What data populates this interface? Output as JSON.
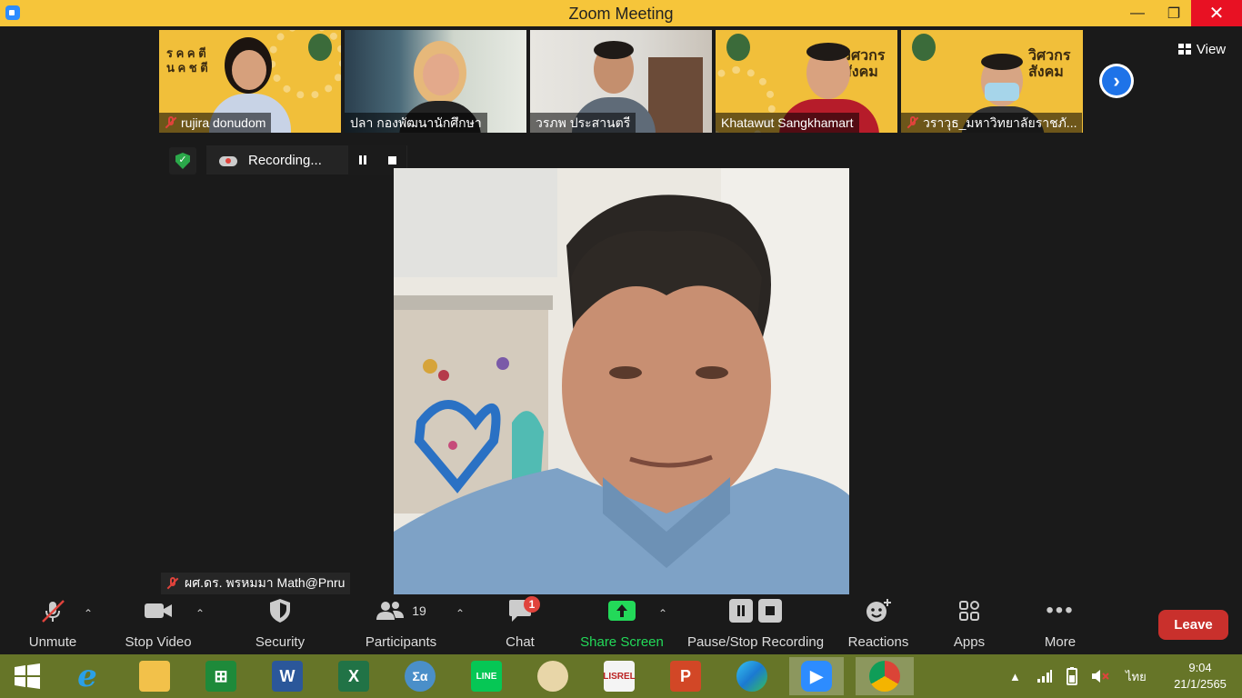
{
  "window": {
    "title": "Zoom Meeting",
    "controls": {
      "minimize": "—",
      "maximize": "❐",
      "close": "✕"
    }
  },
  "participants_strip": [
    {
      "name": "rujira donudom",
      "muted": true
    },
    {
      "name": "ปลา  กองพัฒนานักศึกษา",
      "muted": false
    },
    {
      "name": "วรภพ ประสานตรี",
      "muted": false
    },
    {
      "name": "Khatawut Sangkhamart",
      "muted": false
    },
    {
      "name": "วราวุธ_มหาวิทยาลัยราชภั...",
      "muted": true
    }
  ],
  "view_button": {
    "label": "View"
  },
  "recording": {
    "label": "Recording..."
  },
  "active_speaker": {
    "name": "ผศ.ดร. พรหมมา Math@Pnru",
    "muted": true
  },
  "toolbar": {
    "unmute": "Unmute",
    "stop_video": "Stop Video",
    "security": "Security",
    "participants": "Participants",
    "participants_count": "19",
    "chat": "Chat",
    "chat_badge": "1",
    "share_screen": "Share Screen",
    "pause_stop_recording": "Pause/Stop Recording",
    "reactions": "Reactions",
    "apps": "Apps",
    "more": "More",
    "leave": "Leave"
  },
  "taskbar": {
    "apps": [
      "start",
      "internet-explorer",
      "file-explorer",
      "store",
      "word",
      "excel",
      "math-input",
      "line",
      "paint",
      "lisrel",
      "powerpoint",
      "edge",
      "zoom",
      "chrome"
    ],
    "tray": {
      "language": "ไทย",
      "time": "9:04",
      "date": "21/1/2565"
    }
  },
  "colors": {
    "title_bar": "#f6c53a",
    "taskbar": "#667528",
    "leave": "#c9302c",
    "share_screen": "#23d959",
    "accent_blue": "#1e73e8"
  }
}
